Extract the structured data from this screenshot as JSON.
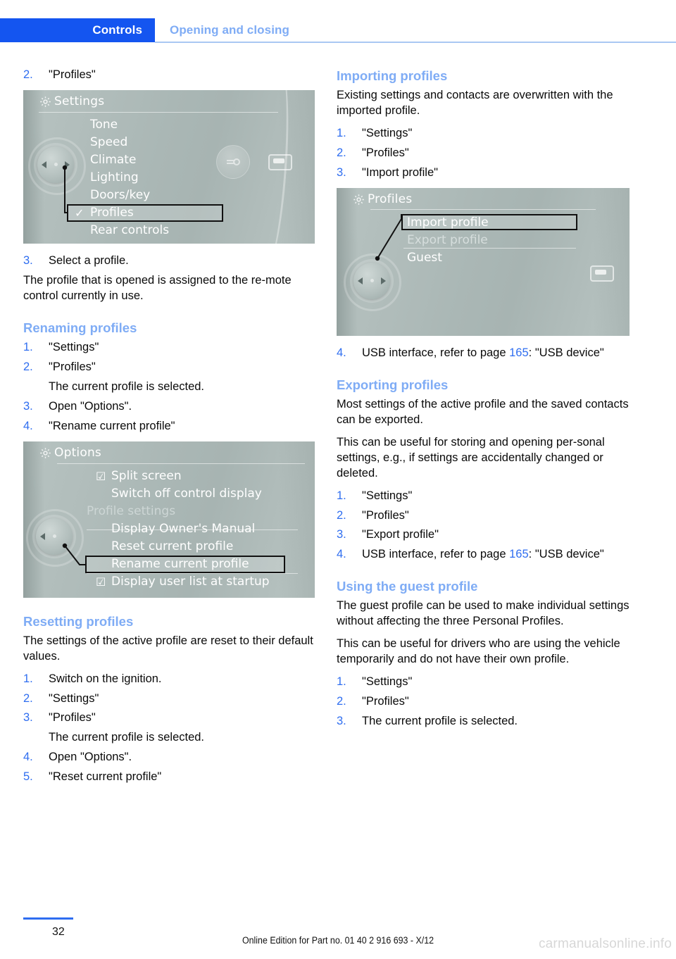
{
  "header": {
    "tab_label": "Controls",
    "section_label": "Opening and closing"
  },
  "left_column": {
    "step_profiles": {
      "num": "2.",
      "text": "\"Profiles\""
    },
    "screen_settings": {
      "title": "Settings",
      "gear_icon": "gear-icon",
      "items": [
        {
          "label": "Tone",
          "checked": false,
          "selected": false
        },
        {
          "label": "Speed",
          "checked": false,
          "selected": false
        },
        {
          "label": "Climate",
          "checked": false,
          "selected": false
        },
        {
          "label": "Lighting",
          "checked": false,
          "selected": false
        },
        {
          "label": "Doors/key",
          "checked": false,
          "selected": false
        },
        {
          "label": "Profiles",
          "checked": true,
          "selected": true
        },
        {
          "label": "Rear controls",
          "checked": false,
          "selected": false
        }
      ]
    },
    "step_select": {
      "num": "3.",
      "text": "Select a profile."
    },
    "para_assigned": "The profile that is opened is assigned to the re-mote control currently in use.",
    "renaming": {
      "heading": "Renaming profiles",
      "steps": [
        {
          "num": "1.",
          "text": "\"Settings\""
        },
        {
          "num": "2.",
          "text": "\"Profiles\""
        },
        {
          "num": "3.",
          "text": "Open \"Options\"."
        },
        {
          "num": "4.",
          "text": "\"Rename current profile\""
        }
      ],
      "note_after_step2": "The current profile is selected."
    },
    "screen_options": {
      "title": "Options",
      "gear_icon": "gear-icon",
      "items": [
        {
          "label": "Split screen",
          "checkbox": true,
          "group": false,
          "selected": false
        },
        {
          "label": "Switch off control display",
          "checkbox": false,
          "group": false,
          "selected": false
        },
        {
          "label": "Profile settings",
          "checkbox": false,
          "group": true,
          "selected": false
        },
        {
          "label": "Display Owner's Manual",
          "checkbox": false,
          "group": false,
          "selected": false
        },
        {
          "label": "Reset current profile",
          "checkbox": false,
          "group": false,
          "selected": false
        },
        {
          "label": "Rename current profile",
          "checkbox": false,
          "group": false,
          "selected": true
        },
        {
          "label": "Display user list at startup",
          "checkbox": true,
          "group": false,
          "selected": false
        }
      ]
    },
    "resetting": {
      "heading": "Resetting profiles",
      "para": "The settings of the active profile are reset to their default values.",
      "steps": [
        {
          "num": "1.",
          "text": "Switch on the ignition."
        },
        {
          "num": "2.",
          "text": "\"Settings\""
        },
        {
          "num": "3.",
          "text": "\"Profiles\""
        },
        {
          "num": "4.",
          "text": "Open \"Options\"."
        },
        {
          "num": "5.",
          "text": "\"Reset current profile\""
        }
      ],
      "note_after_step3": "The current profile is selected."
    }
  },
  "right_column": {
    "importing": {
      "heading": "Importing profiles",
      "para": "Existing settings and contacts are overwritten with the imported profile.",
      "steps": [
        {
          "num": "1.",
          "text": "\"Settings\""
        },
        {
          "num": "2.",
          "text": "\"Profiles\""
        },
        {
          "num": "3.",
          "text": "\"Import profile\""
        }
      ]
    },
    "screen_profiles": {
      "title": "Profiles",
      "gear_icon": "gear-icon",
      "items": [
        {
          "label": "Import profile",
          "selected": true
        },
        {
          "label": "Export profile",
          "selected": false
        },
        {
          "label": "Guest",
          "selected": false
        }
      ]
    },
    "step_usb_import": {
      "num": "4.",
      "text_before": "USB interface, refer to page ",
      "page_ref": "165",
      "text_after": ": \"USB device\""
    },
    "exporting": {
      "heading": "Exporting profiles",
      "para1": "Most settings of the active profile and the saved contacts can be exported.",
      "para2": "This can be useful for storing and opening per-sonal settings, e.g., if settings are accidentally changed or deleted.",
      "steps": [
        {
          "num": "1.",
          "text": "\"Settings\""
        },
        {
          "num": "2.",
          "text": "\"Profiles\""
        },
        {
          "num": "3.",
          "text": "\"Export profile\""
        }
      ],
      "step_usb": {
        "num": "4.",
        "text_before": "USB interface, refer to page ",
        "page_ref": "165",
        "text_after": ": \"USB device\""
      }
    },
    "guest": {
      "heading": "Using the guest profile",
      "para1": "The guest profile can be used to make individual settings without affecting the three Personal Profiles.",
      "para2": "This can be useful for drivers who are using the vehicle temporarily and do not have their own profile.",
      "steps": [
        {
          "num": "1.",
          "text": "\"Settings\""
        },
        {
          "num": "2.",
          "text": "\"Profiles\""
        },
        {
          "num": "3.",
          "text": "The current profile is selected."
        }
      ]
    }
  },
  "footer": {
    "page_number": "32",
    "note": "Online Edition for Part no. 01 40 2 916 693 - X/12",
    "watermark": "carmanualsonline.info"
  },
  "colors": {
    "header_tab_bg": "#1455f0",
    "heading_blue": "#7facf5",
    "number_blue": "#2f6ef0",
    "screen_bg": "#aab7b5"
  }
}
